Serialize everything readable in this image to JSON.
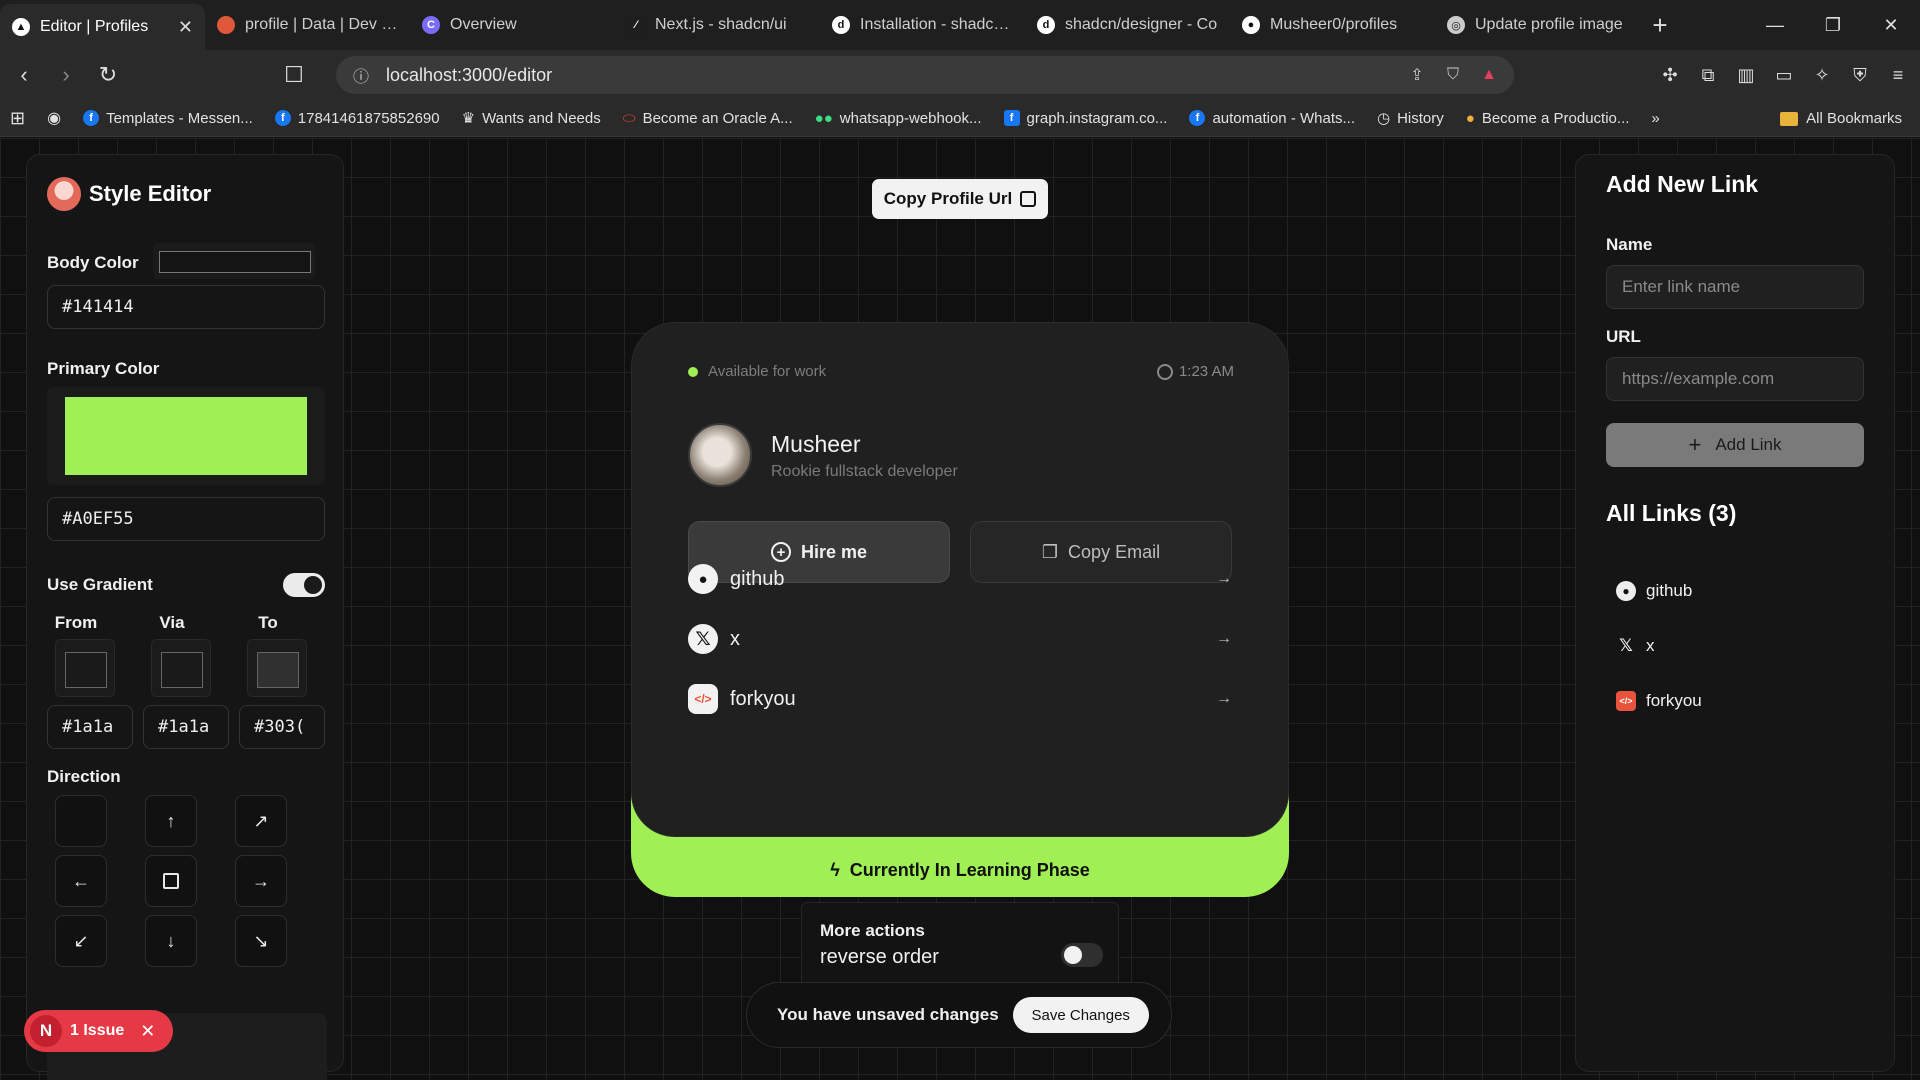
{
  "browser": {
    "tabs": [
      {
        "label": "Editor | Profiles",
        "fav": "A",
        "favColor": "#ffffff",
        "active": true
      },
      {
        "label": "profile | Data | Dev | p",
        "fav": "◔",
        "favColor": "#e0583a",
        "active": false
      },
      {
        "label": "Overview",
        "fav": "C",
        "favColor": "#7b6cf6",
        "active": false
      },
      {
        "label": "Next.js - shadcn/ui",
        "fav": "⁄",
        "favColor": "#ffffff",
        "active": false
      },
      {
        "label": "Installation - shadcn/c",
        "fav": "d",
        "favColor": "#ffffff",
        "active": false
      },
      {
        "label": "shadcn/designer - Co",
        "fav": "d",
        "favColor": "#ffffff",
        "active": false
      },
      {
        "label": "Musheer0/profiles",
        "fav": "●",
        "favColor": "#ffffff",
        "active": false
      },
      {
        "label": "Update profile image",
        "fav": "◎",
        "favColor": "#cccccc",
        "active": false
      }
    ],
    "url": "localhost:3000/editor",
    "bookmarks": [
      {
        "label": "Templates - Messen...",
        "icon": "f"
      },
      {
        "label": "17841461875852690",
        "icon": "f"
      },
      {
        "label": "Wants and Needs",
        "icon": "w"
      },
      {
        "label": "Become an Oracle A...",
        "icon": "o"
      },
      {
        "label": "whatsapp-webhook...",
        "icon": "g"
      },
      {
        "label": "graph.instagram.co...",
        "icon": "f"
      },
      {
        "label": "automation - Whats...",
        "icon": "f"
      },
      {
        "label": "History",
        "icon": "h"
      },
      {
        "label": "Become a Productio...",
        "icon": "b"
      }
    ],
    "all_bookmarks": "All Bookmarks"
  },
  "style_editor": {
    "title": "Style Editor",
    "body_color_label": "Body Color",
    "body_color_value": "#141414",
    "primary_color_label": "Primary Color",
    "primary_color_value": "#A0EF55",
    "primary_color_swatch": "#a0ef55",
    "use_gradient_label": "Use Gradient",
    "use_gradient_on": true,
    "gradient": {
      "from_label": "From",
      "via_label": "Via",
      "to_label": "To",
      "from_value": "#1a1a",
      "via_value": "#1a1a",
      "to_value": "#303(",
      "from_swatch": "#1a1a1a",
      "via_swatch": "#1a1a1a",
      "to_swatch": "#303030"
    },
    "direction_label": "Direction"
  },
  "issues": {
    "avatar": "N",
    "label": "1 Issue"
  },
  "center": {
    "copy_profile_url": "Copy Profile Url",
    "card": {
      "availability": "Available for work",
      "time": "1:23 AM",
      "name": "Musheer",
      "bio": "Rookie fullstack developer",
      "hire_me": "Hire me",
      "copy_email": "Copy Email",
      "links": [
        {
          "name": "github",
          "icon": "github-icon"
        },
        {
          "name": "x",
          "icon": "x-icon"
        },
        {
          "name": "forkyou",
          "icon": "forkyou-icon"
        }
      ],
      "phase": "Currently In Learning Phase"
    },
    "more_actions": {
      "title": "More actions",
      "subtitle": "reverse order",
      "reverse_on": false
    },
    "unsaved": {
      "message": "You have unsaved changes",
      "save_label": "Save Changes"
    }
  },
  "add_link": {
    "title": "Add New Link",
    "name_label": "Name",
    "name_placeholder": "Enter link name",
    "url_label": "URL",
    "url_placeholder": "https://example.com",
    "button_label": "Add Link",
    "all_links_title": "All Links (3)",
    "links": [
      "github",
      "x",
      "forkyou"
    ]
  }
}
